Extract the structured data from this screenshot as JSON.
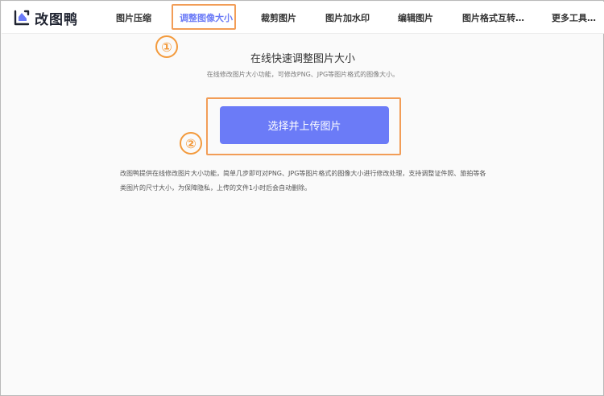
{
  "header": {
    "logo_text": "改图鸭",
    "nav": [
      {
        "label": "图片压缩"
      },
      {
        "label": "调整图像大小"
      },
      {
        "label": "裁剪图片"
      },
      {
        "label": "图片加水印"
      },
      {
        "label": "编辑图片"
      },
      {
        "label": "图片格式互转…"
      },
      {
        "label": "更多工具…"
      }
    ],
    "accent_color": "#6b7bf7"
  },
  "markers": {
    "first": "①",
    "second": "②"
  },
  "highlight_color": "#f29d57",
  "main": {
    "title": "在线快速调整图片大小",
    "subtitle": "在线修改图片大小功能，可修改PNG、JPG等图片格式的图像大小。",
    "upload_button": "选择并上传图片",
    "description": "改图鸭提供在线修改图片大小功能，简单几步即可对PNG、JPG等图片格式的图像大小进行修改处理，支持调整证件照、旅拍等各类图片的尺寸大小，为保障隐私，上传的文件1小时后会自动删除。"
  }
}
